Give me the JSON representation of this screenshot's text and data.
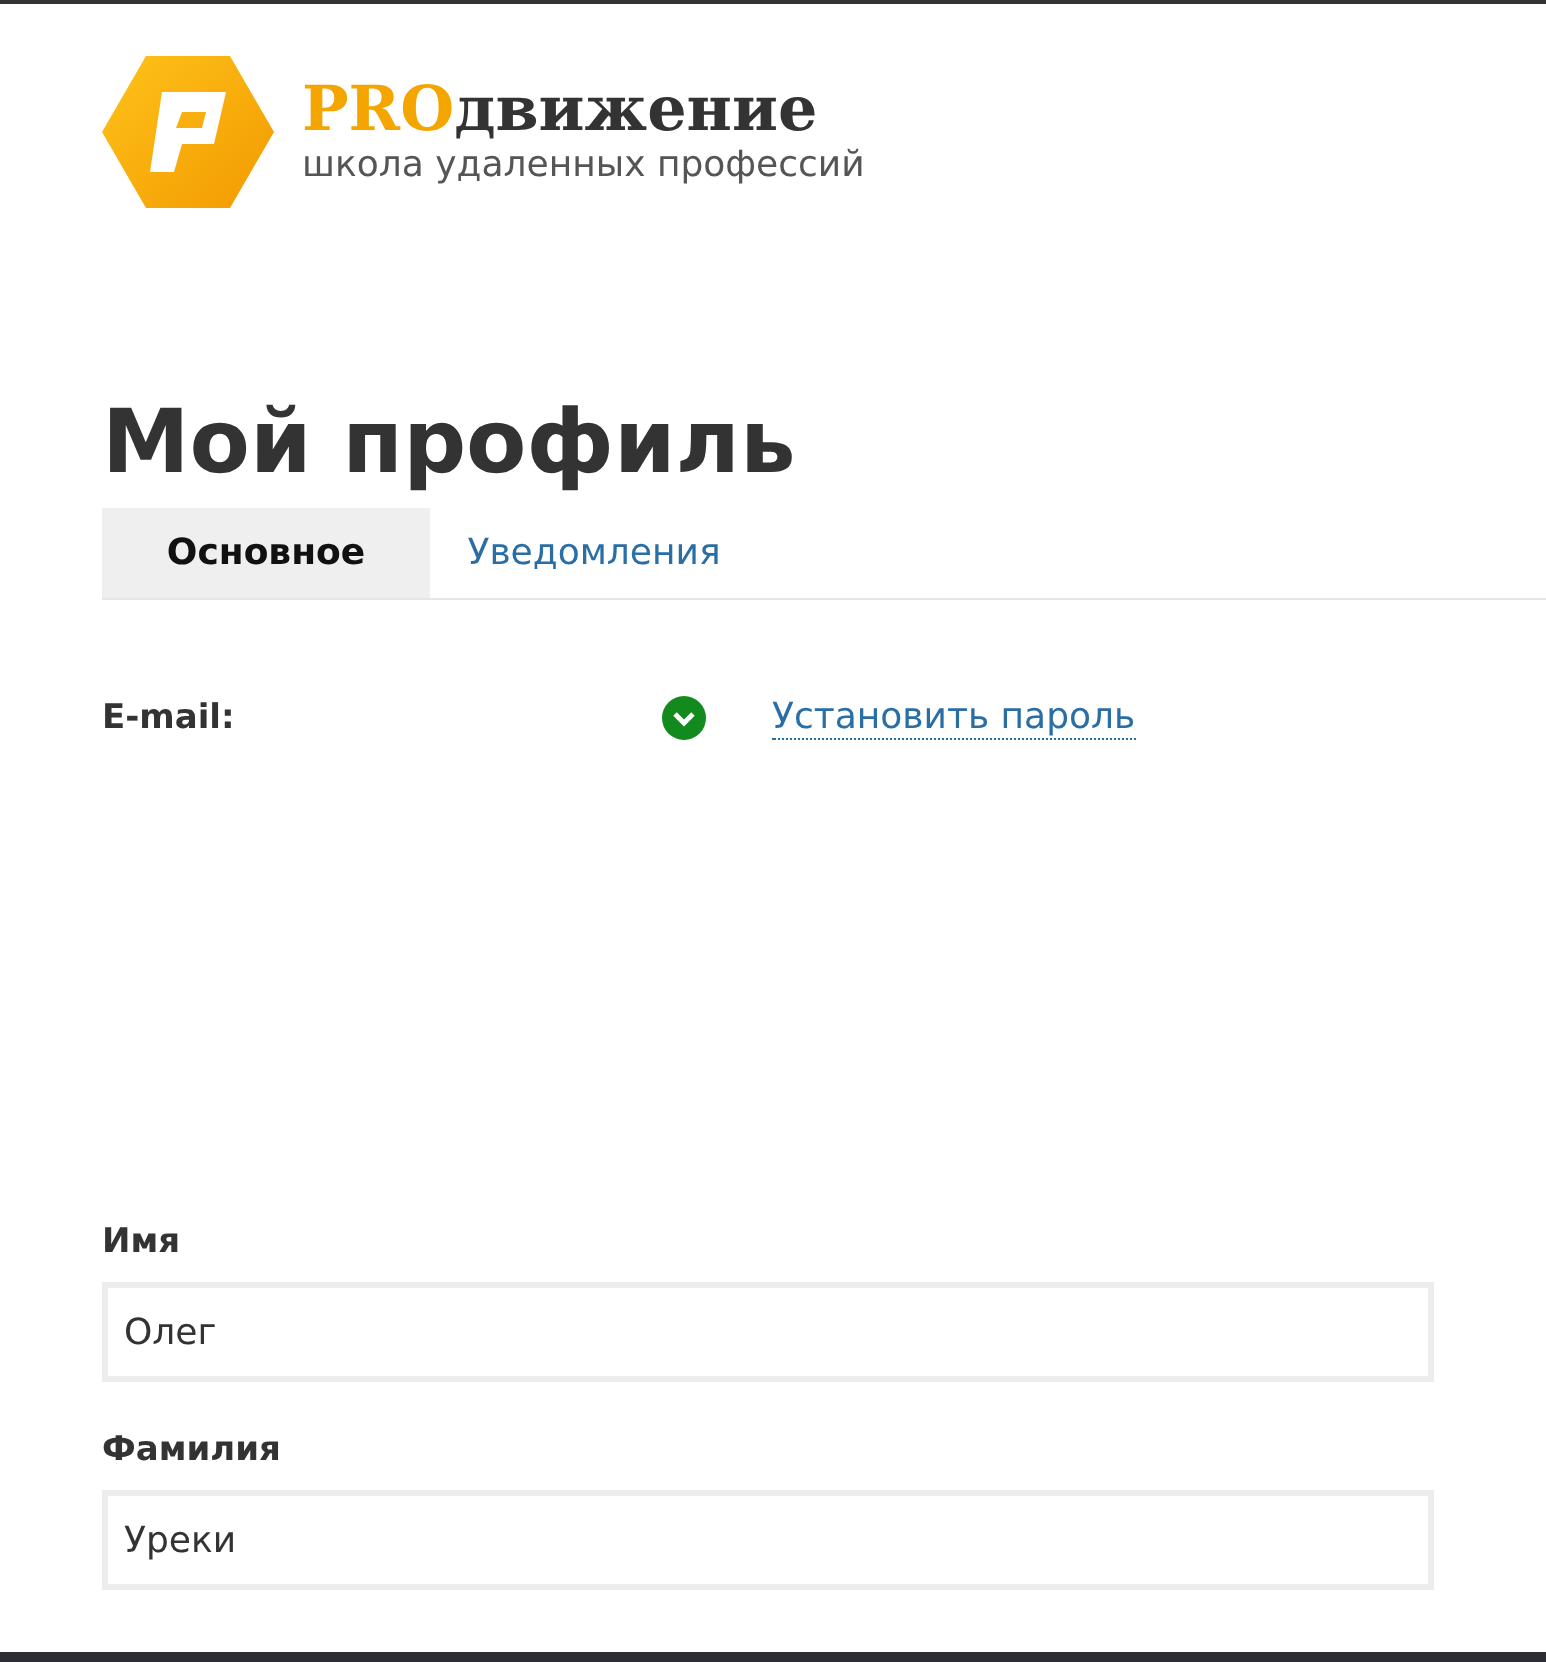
{
  "logo": {
    "accent": "PRO",
    "name": "движение",
    "tagline": "школа удаленных профессий"
  },
  "title": "Мой профиль",
  "tabs": [
    {
      "label": "Основное",
      "selected": true
    },
    {
      "label": "Уведомления",
      "selected": false
    }
  ],
  "email": {
    "label": "E-mail",
    "separator": ":",
    "verified": true,
    "link": "Установить пароль"
  },
  "fields": [
    {
      "label": "Имя",
      "value": "Олег"
    },
    {
      "label": "Фамилия",
      "value": "Уреки"
    }
  ]
}
